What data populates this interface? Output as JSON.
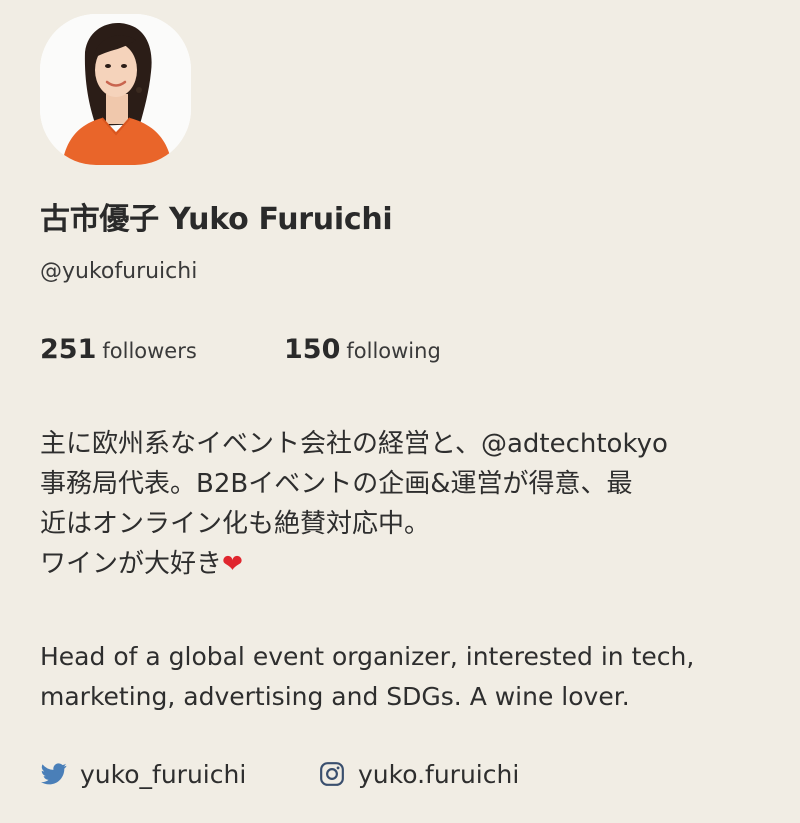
{
  "profile": {
    "display_name": "古市優子 Yuko Furuichi",
    "username": "@yukofuruichi"
  },
  "stats": {
    "followers_count": "251",
    "followers_label": "followers",
    "following_count": "150",
    "following_label": "following"
  },
  "bio": {
    "ja_lines": [
      "主に欧州系なイベント会社の経営と、@adtechtokyo",
      "事務局代表。B2Bイベントの企画&運営が得意、最",
      "近はオンライン化も絶賛対応中。",
      "ワインが大好き"
    ],
    "heart": "❤",
    "en_lines": [
      "Head of a global event organizer,  interested in tech,",
      "marketing, advertising and SDGs.  A wine lover."
    ]
  },
  "socials": {
    "twitter": {
      "icon": "twitter-bird-icon",
      "handle": "yuko_furuichi"
    },
    "instagram": {
      "icon": "instagram-icon",
      "handle": "yuko.furuichi"
    }
  },
  "colors": {
    "background": "#f1ede4",
    "text": "#2b2b2b",
    "twitter_blue": "#4a7fb8",
    "instagram_icon": "#3a4f6e",
    "heart_red": "#e0262e",
    "avatar_top": "#ffffff",
    "sweater": "#e9652a"
  }
}
